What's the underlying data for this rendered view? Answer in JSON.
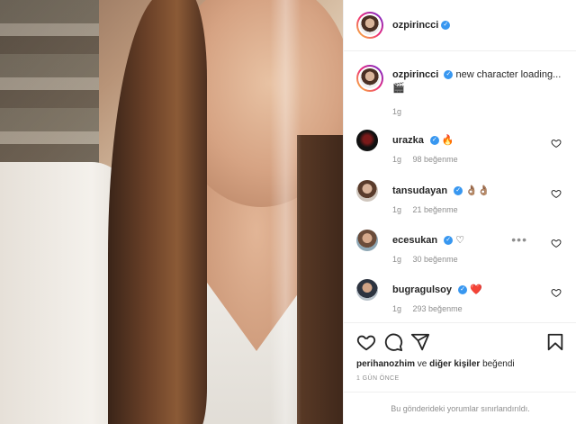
{
  "post": {
    "author": "ozpirincci",
    "caption_text": "new character loading...",
    "caption_emoji": "🎬",
    "caption_time": "1g"
  },
  "comments": [
    {
      "username": "urazka",
      "text": "🔥",
      "time": "1g",
      "likes": "98 beğenme"
    },
    {
      "username": "tansudayan",
      "text": "👌🏽👌🏽",
      "time": "1g",
      "likes": "21 beğenme"
    },
    {
      "username": "ecesukan",
      "text": "♡",
      "time": "1g",
      "likes": "30 beğenme",
      "more": "•••"
    },
    {
      "username": "bugragulsoy",
      "text": "❤️",
      "time": "1g",
      "likes": "293 beğenme"
    }
  ],
  "likes_line": {
    "user": "perihanozhim",
    "connector": "ve",
    "others": "diğer kişiler",
    "verb": "beğendi"
  },
  "post_date": "1 GÜN ÖNCE",
  "comments_limited": "Bu gönderideki yorumlar sınırlandırıldı.",
  "verified_mark": "✓",
  "colors": {
    "verified": "#3897f0",
    "heart_red": "#ed4956",
    "muted": "#8e8e8e"
  },
  "icons": [
    "heart-icon",
    "comment-icon",
    "share-icon",
    "bookmark-icon",
    "verified-badge-icon",
    "more-options-icon"
  ]
}
